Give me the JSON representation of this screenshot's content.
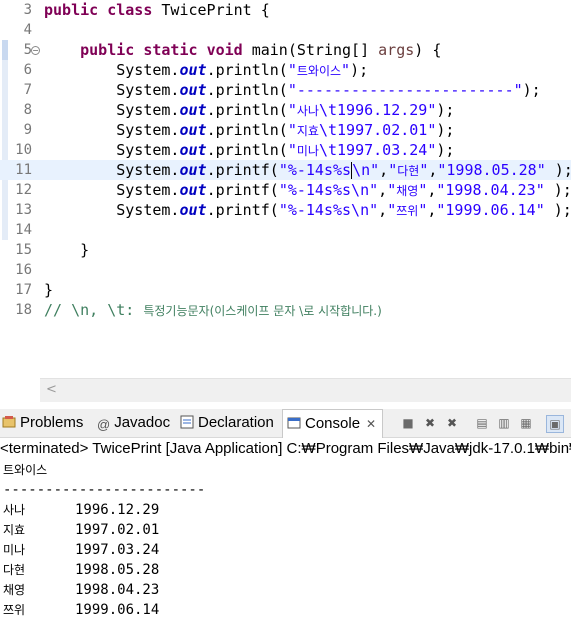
{
  "editor": {
    "lines": [
      {
        "num": "3",
        "tokens": [
          {
            "t": "kw",
            "v": "public"
          },
          {
            "t": "p",
            "v": " "
          },
          {
            "t": "kw",
            "v": "class"
          },
          {
            "t": "p",
            "v": " TwicePrint {"
          }
        ]
      },
      {
        "num": "4",
        "tokens": []
      },
      {
        "num": "5",
        "fold": true,
        "tokens": [
          {
            "t": "p",
            "v": "    "
          },
          {
            "t": "kw",
            "v": "public"
          },
          {
            "t": "p",
            "v": " "
          },
          {
            "t": "kw",
            "v": "static"
          },
          {
            "t": "p",
            "v": " "
          },
          {
            "t": "kw",
            "v": "void"
          },
          {
            "t": "p",
            "v": " main(String[] "
          },
          {
            "t": "param",
            "v": "args"
          },
          {
            "t": "p",
            "v": ") {"
          }
        ]
      },
      {
        "num": "6",
        "tokens": [
          {
            "t": "p",
            "v": "        System."
          },
          {
            "t": "fld",
            "v": "out"
          },
          {
            "t": "p",
            "v": ".println("
          },
          {
            "t": "str",
            "v": "\""
          },
          {
            "t": "strkr",
            "v": "트와이스"
          },
          {
            "t": "str",
            "v": "\""
          },
          {
            "t": "p",
            "v": ");"
          }
        ]
      },
      {
        "num": "7",
        "tokens": [
          {
            "t": "p",
            "v": "        System."
          },
          {
            "t": "fld",
            "v": "out"
          },
          {
            "t": "p",
            "v": ".println("
          },
          {
            "t": "str",
            "v": "\"------------------------\""
          },
          {
            "t": "p",
            "v": ");"
          }
        ]
      },
      {
        "num": "8",
        "tokens": [
          {
            "t": "p",
            "v": "        System."
          },
          {
            "t": "fld",
            "v": "out"
          },
          {
            "t": "p",
            "v": ".println("
          },
          {
            "t": "str",
            "v": "\""
          },
          {
            "t": "strkr",
            "v": "사나"
          },
          {
            "t": "str",
            "v": "\\t1996.12.29\""
          },
          {
            "t": "p",
            "v": ");"
          }
        ]
      },
      {
        "num": "9",
        "tokens": [
          {
            "t": "p",
            "v": "        System."
          },
          {
            "t": "fld",
            "v": "out"
          },
          {
            "t": "p",
            "v": ".println("
          },
          {
            "t": "str",
            "v": "\""
          },
          {
            "t": "strkr",
            "v": "지효"
          },
          {
            "t": "str",
            "v": "\\t1997.02.01\""
          },
          {
            "t": "p",
            "v": ");"
          }
        ]
      },
      {
        "num": "10",
        "tokens": [
          {
            "t": "p",
            "v": "        System."
          },
          {
            "t": "fld",
            "v": "out"
          },
          {
            "t": "p",
            "v": ".println("
          },
          {
            "t": "str",
            "v": "\""
          },
          {
            "t": "strkr",
            "v": "미나"
          },
          {
            "t": "str",
            "v": "\\t1997.03.24\""
          },
          {
            "t": "p",
            "v": ");"
          }
        ]
      },
      {
        "num": "11",
        "current": true,
        "tokens": [
          {
            "t": "p",
            "v": "        System."
          },
          {
            "t": "fld",
            "v": "out"
          },
          {
            "t": "p",
            "v": ".printf("
          },
          {
            "t": "str",
            "v": "\"%-14s%s"
          },
          {
            "t": "caret",
            "v": ""
          },
          {
            "t": "str",
            "v": "\\n\""
          },
          {
            "t": "p",
            "v": ","
          },
          {
            "t": "str",
            "v": "\""
          },
          {
            "t": "strkr",
            "v": "다현"
          },
          {
            "t": "str",
            "v": "\""
          },
          {
            "t": "p",
            "v": ","
          },
          {
            "t": "str",
            "v": "\"1998.05.28\""
          },
          {
            "t": "p",
            "v": " );"
          }
        ]
      },
      {
        "num": "12",
        "tokens": [
          {
            "t": "p",
            "v": "        System."
          },
          {
            "t": "fld",
            "v": "out"
          },
          {
            "t": "p",
            "v": ".printf("
          },
          {
            "t": "str",
            "v": "\"%-14s%s\\n\""
          },
          {
            "t": "p",
            "v": ","
          },
          {
            "t": "str",
            "v": "\""
          },
          {
            "t": "strkr",
            "v": "채영"
          },
          {
            "t": "str",
            "v": "\""
          },
          {
            "t": "p",
            "v": ","
          },
          {
            "t": "str",
            "v": "\"1998.04.23\""
          },
          {
            "t": "p",
            "v": " );"
          }
        ]
      },
      {
        "num": "13",
        "tokens": [
          {
            "t": "p",
            "v": "        System."
          },
          {
            "t": "fld",
            "v": "out"
          },
          {
            "t": "p",
            "v": ".printf("
          },
          {
            "t": "str",
            "v": "\"%-14s%s\\n\""
          },
          {
            "t": "p",
            "v": ","
          },
          {
            "t": "str",
            "v": "\""
          },
          {
            "t": "strkr",
            "v": "쯔위"
          },
          {
            "t": "str",
            "v": "\""
          },
          {
            "t": "p",
            "v": ","
          },
          {
            "t": "str",
            "v": "\"1999.06.14\""
          },
          {
            "t": "p",
            "v": " );"
          }
        ]
      },
      {
        "num": "14",
        "tokens": []
      },
      {
        "num": "15",
        "tokens": [
          {
            "t": "p",
            "v": "    }"
          }
        ]
      },
      {
        "num": "16",
        "tokens": []
      },
      {
        "num": "17",
        "tokens": [
          {
            "t": "p",
            "v": "}"
          }
        ]
      },
      {
        "num": "18",
        "tokens": [
          {
            "t": "cmt",
            "v": "// \\n, \\t: "
          },
          {
            "t": "cmtkr",
            "v": "특정기능문자(이스케이프 문자 \\로 시작합니다.)"
          }
        ]
      }
    ]
  },
  "views": {
    "tabs": [
      {
        "label": "Problems",
        "icon": "problems-icon",
        "active": false
      },
      {
        "label": "Javadoc",
        "icon": "javadoc-icon",
        "active": false
      },
      {
        "label": "Declaration",
        "icon": "declaration-icon",
        "active": false
      },
      {
        "label": "Console",
        "icon": "console-icon",
        "active": true,
        "close": "✕"
      }
    ]
  },
  "console": {
    "status": "<terminated> TwicePrint [Java Application] C:₩Program Files₩Java₩jdk-17.0.1₩bin₩",
    "output": [
      {
        "name": "트와이스",
        "date": ""
      },
      {
        "name": "------------------------",
        "date": ""
      },
      {
        "name": "사나",
        "date": "1996.12.29"
      },
      {
        "name": "지효",
        "date": "1997.02.01"
      },
      {
        "name": "미나",
        "date": "1997.03.24"
      },
      {
        "name": "다현",
        "date": "1998.05.28"
      },
      {
        "name": "채영",
        "date": "1998.04.23"
      },
      {
        "name": "쯔위",
        "date": "1999.06.14"
      }
    ]
  },
  "colors": {
    "keyword": "#7f0055",
    "string": "#2a00ff",
    "field": "#0000c0",
    "comment": "#3f7f5f",
    "current_line": "#e8f2fe"
  }
}
